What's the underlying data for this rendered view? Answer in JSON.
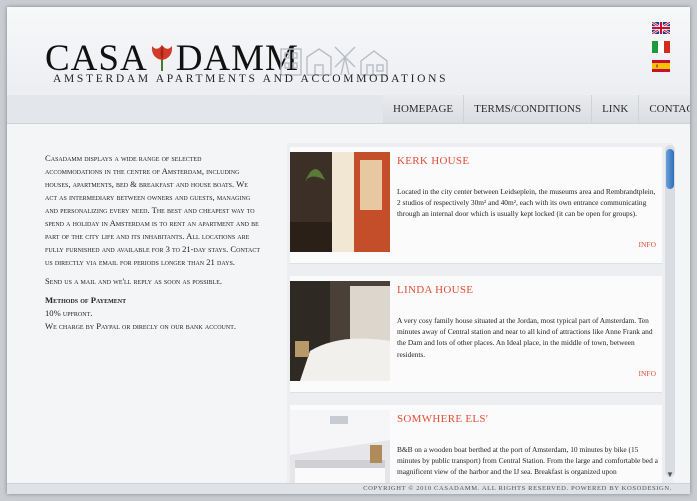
{
  "brand": {
    "logo_left": "CASA",
    "logo_right": "DAMM",
    "tagline": "AMSTERDAM APARTMENTS AND ACCOMMODATIONS",
    "accent": "#e04d35"
  },
  "languages": [
    "english-flag",
    "italian-flag",
    "spanish-flag"
  ],
  "nav": {
    "items": [
      "HOMEPAGE",
      "TERMS/CONDITIONS",
      "LINK",
      "CONTACTS"
    ]
  },
  "intro": {
    "paragraph": "Casadamm displays a wide range of selected accommodations in the centre of Amsterdam, including houses, apartments, bed & breakfast and house boats. We act as intermediary between owners and guests, managing and personalizing every need. The best and cheapest way to spend a holiday in Amsterdam is to rent an apartment and be part of the city life and its inhabitants. All locations are fully furnished and available for 3 to 21-day stays. Contact us directly via email for periods longer than 21 days.",
    "mail_line": "Send us a mail and we'll reply as soon as possible.",
    "payment_heading": "Methods of Payement",
    "payment_lines": [
      "10% upfront.",
      "We charge by Paypal or direcly on our bank account."
    ]
  },
  "listings": [
    {
      "title": "KERK HOUSE",
      "description": "Located in the city center between Leidseplein, the museums area and Rembrandtplein, 2 studios of respectively 30m² and 40m², each with its own entrance communicating through an internal door which is usually kept locked (it can be open for groups).",
      "link": "INFO"
    },
    {
      "title": "LINDA HOUSE",
      "description": "A very cosy family house situated at the Jordan, most typical part of Amsterdam. Ten minutes away of Central station and near to all kind of attractions like Anne Frank and the Dam and lots of other places. An Ideal place, in the middle of town, between residents.",
      "link": "INFO"
    },
    {
      "title": "SOMWHERE ELS'",
      "description": "B&B on a wooden boat berthed at the port of Amsterdam, 10 minutes by bike (15 minutes by public transport) from Central Station. From the large and comfortable bed a magnificent view of the harbor and the IJ sea. Breakfast is organized upon",
      "link": ""
    }
  ],
  "footer": {
    "copyright": "COPYRIGHT © 2010 CASADAMM. ALL RIGHTS RESERVED. POWERED BY KOSODESIGN."
  }
}
